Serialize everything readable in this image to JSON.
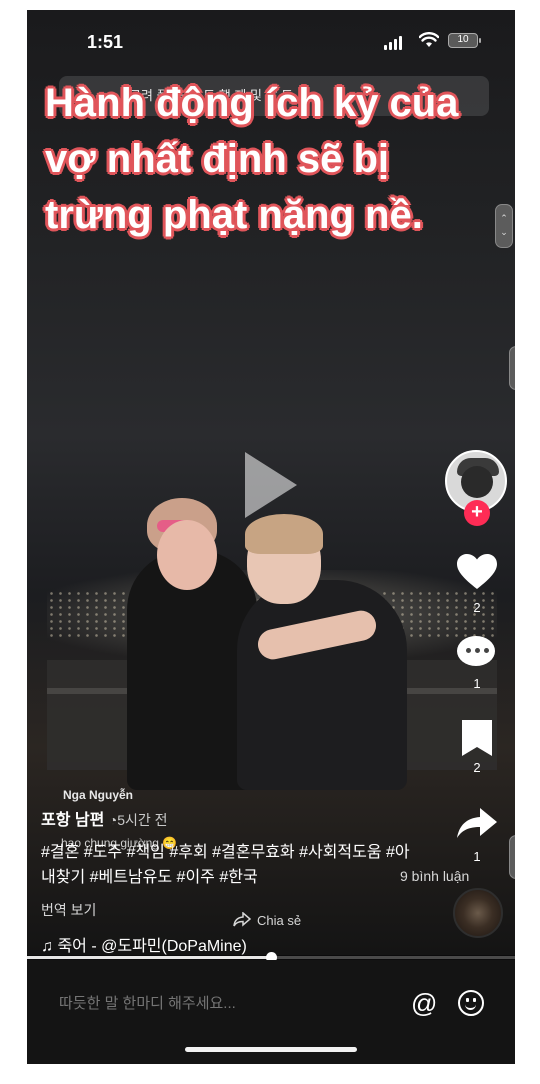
{
  "status_bar": {
    "time": "1:51",
    "battery": "10"
  },
  "search": {
    "text": "고려 플 등 표 도 행 제 및 남 도 모"
  },
  "video": {
    "headline": "Hành động ích kỷ của vợ nhất định sẽ bị trừng phạt nặng nề.",
    "user_tag": "Nga Nguyễn",
    "overlay_caption": "hao chung giường 😁"
  },
  "rail": {
    "likes": "2",
    "comments": "1",
    "bookmarks": "2",
    "shares": "1",
    "comments_label": "9 bình luận"
  },
  "caption": {
    "username": "포항 남편",
    "time_ago": "5시간 전",
    "hashtags": "#결혼 #도주 #책임 #후회 #결혼무효화 #사회적도움 #아내찾기 #베트남유도 #이주 #한국",
    "translate": "번역 보기",
    "share_link": "Chia sẻ",
    "music": "♫ 죽어 - @도파민(DoPaMine)"
  },
  "playback": {
    "progress": 0.5
  },
  "comment_bar": {
    "placeholder": "따듯한 말 한마디 해주세요..."
  },
  "icons": [
    "play-icon",
    "heart-icon",
    "comment-icon",
    "bookmark-icon",
    "share-icon",
    "at-icon",
    "emoji-icon",
    "follow-plus-icon",
    "music-note-icon"
  ],
  "colors": {
    "headline_outline": "#e0555a",
    "follow_button": "#fe2c55",
    "background": "#0b0b0c"
  }
}
